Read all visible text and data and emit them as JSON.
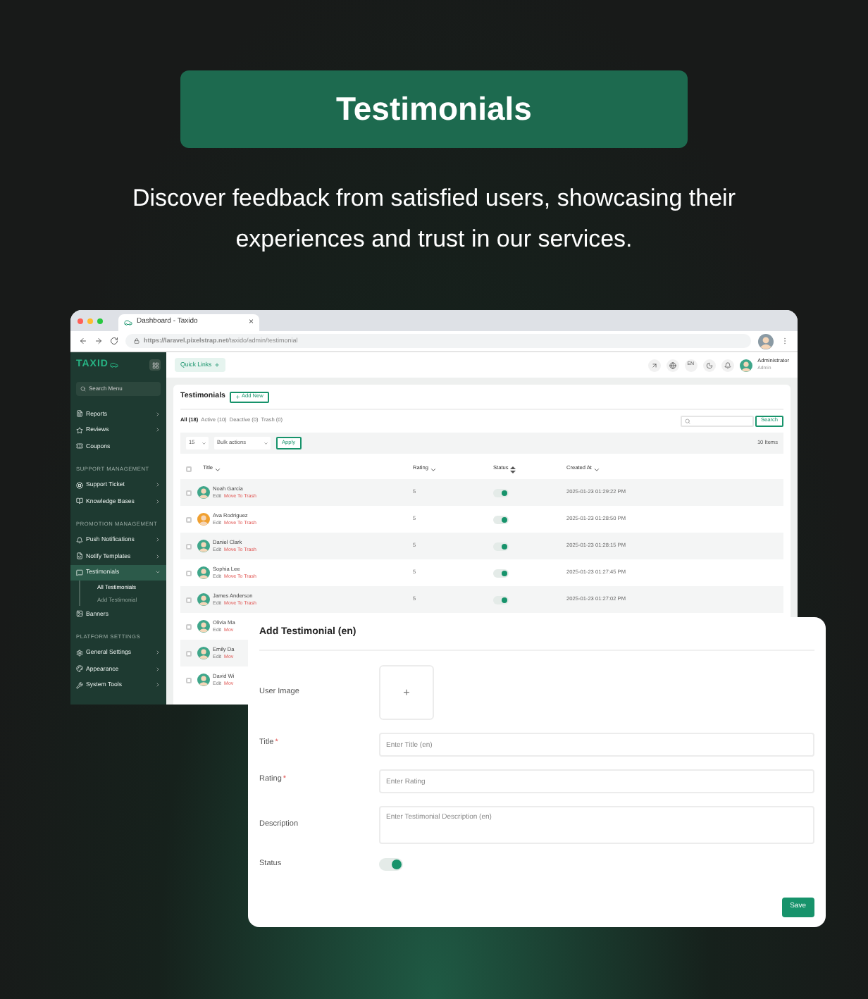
{
  "banner": {
    "title": "Testimonials"
  },
  "subtitle": "Discover feedback from satisfied users, showcasing their experiences and trust in our services.",
  "browser": {
    "tab_title": "Dashboard - Taxido",
    "tab_close": "×",
    "url": "**https://laravel.pixelstrap.net**/taxido/admin/testimonial"
  },
  "sidebar": {
    "logo": "TAXID",
    "search_placeholder": "Search Menu",
    "items": [
      {
        "kind": "item",
        "label": "Reports",
        "chevron": true,
        "selected": false
      },
      {
        "kind": "item",
        "label": "Reviews",
        "chevron": true,
        "selected": false
      },
      {
        "kind": "item",
        "label": "Coupons",
        "chevron": false,
        "selected": false
      },
      {
        "kind": "heading",
        "label": "SUPPORT MANAGEMENT"
      },
      {
        "kind": "item",
        "label": "Support Ticket",
        "chevron": true,
        "selected": false
      },
      {
        "kind": "item",
        "label": "Knowledge Bases",
        "chevron": true,
        "selected": false
      },
      {
        "kind": "heading",
        "label": "PROMOTION MANAGEMENT"
      },
      {
        "kind": "item",
        "label": "Push Notifications",
        "chevron": true,
        "selected": false
      },
      {
        "kind": "item",
        "label": "Notify Templates",
        "chevron": true,
        "selected": false
      },
      {
        "kind": "item",
        "label": "Testimonials",
        "chevron": true,
        "selected": true,
        "expanded": true,
        "children": [
          {
            "label": "All Testimonials",
            "selected": true
          },
          {
            "label": "Add Testimonial",
            "selected": false
          }
        ]
      },
      {
        "kind": "item",
        "label": "Banners",
        "chevron": false,
        "selected": false
      },
      {
        "kind": "heading",
        "label": "PLATFORM SETTINGS"
      },
      {
        "kind": "item",
        "label": "General Settings",
        "chevron": true,
        "selected": false
      },
      {
        "kind": "item",
        "label": "Appearance",
        "chevron": true,
        "selected": false
      },
      {
        "kind": "item",
        "label": "System Tools",
        "chevron": true,
        "selected": false
      }
    ]
  },
  "header": {
    "quick_links": "Quick Links",
    "lang": "EN",
    "user_name": "Administrator",
    "user_role": "Admin"
  },
  "card": {
    "title": "Testimonials",
    "add_button": "Add New",
    "filters": [
      {
        "label": "All (18)",
        "selected": true
      },
      {
        "label": "Active (10)",
        "selected": false
      },
      {
        "label": "Deactive (0)",
        "selected": false
      },
      {
        "label": "Trash (0)",
        "selected": false
      }
    ],
    "search_button": "Search",
    "per_page": "15",
    "bulk": "Bulk actions",
    "apply": "Apply",
    "count": "10 Items",
    "select_all_checked": false,
    "columns": [
      {
        "label": "Title"
      },
      {
        "label": "Rating"
      },
      {
        "label": "Status"
      },
      {
        "label": "Created At"
      }
    ],
    "rows": [
      {
        "checked": false,
        "name": "Noah Garcia",
        "edit": "Edit",
        "trash": "Move To Trash",
        "rating": "5",
        "status_on": true,
        "created": "2025-01-23 01:29:22 PM",
        "color": "#3fa68a"
      },
      {
        "checked": false,
        "name": "Ava Rodriguez",
        "edit": "Edit",
        "trash": "Move To Trash",
        "rating": "5",
        "status_on": true,
        "created": "2025-01-23 01:28:50 PM",
        "color": "#f0a030"
      },
      {
        "checked": false,
        "name": "Daniel Clark",
        "edit": "Edit",
        "trash": "Move To Trash",
        "rating": "5",
        "status_on": true,
        "created": "2025-01-23 01:28:15 PM",
        "color": "#3fa68a"
      },
      {
        "checked": false,
        "name": "Sophia Lee",
        "edit": "Edit",
        "trash": "Move To Trash",
        "rating": "5",
        "status_on": true,
        "created": "2025-01-23 01:27:45 PM",
        "color": "#3fa68a"
      },
      {
        "checked": false,
        "name": "James Anderson",
        "edit": "Edit",
        "trash": "Move To Trash",
        "rating": "5",
        "status_on": true,
        "created": "2025-01-23 01:27:02 PM",
        "color": "#3fa68a"
      },
      {
        "checked": false,
        "name": "Olivia Ma",
        "edit": "Edit",
        "trash": "Mov",
        "color": "#3fa68a"
      },
      {
        "checked": false,
        "name": "Emily Da",
        "edit": "Edit",
        "trash": "Mov",
        "color": "#3fa68a"
      },
      {
        "checked": false,
        "name": "David Wi",
        "edit": "Edit",
        "trash": "Mov",
        "color": "#3fa68a"
      }
    ]
  },
  "modal": {
    "title": "Add Testimonial (en)",
    "image_label": "User Image",
    "upload": "+",
    "fields": [
      {
        "kind": "input",
        "label": "Title",
        "required_mark": "*",
        "placeholder": "Enter Title (en)"
      },
      {
        "kind": "input",
        "label": "Rating",
        "required_mark": "*",
        "placeholder": "Enter Rating"
      },
      {
        "kind": "textarea",
        "label": "Description",
        "placeholder": "Enter Testimonial Description (en)"
      }
    ],
    "status_label": "Status",
    "status_on": true,
    "save": "Save"
  }
}
